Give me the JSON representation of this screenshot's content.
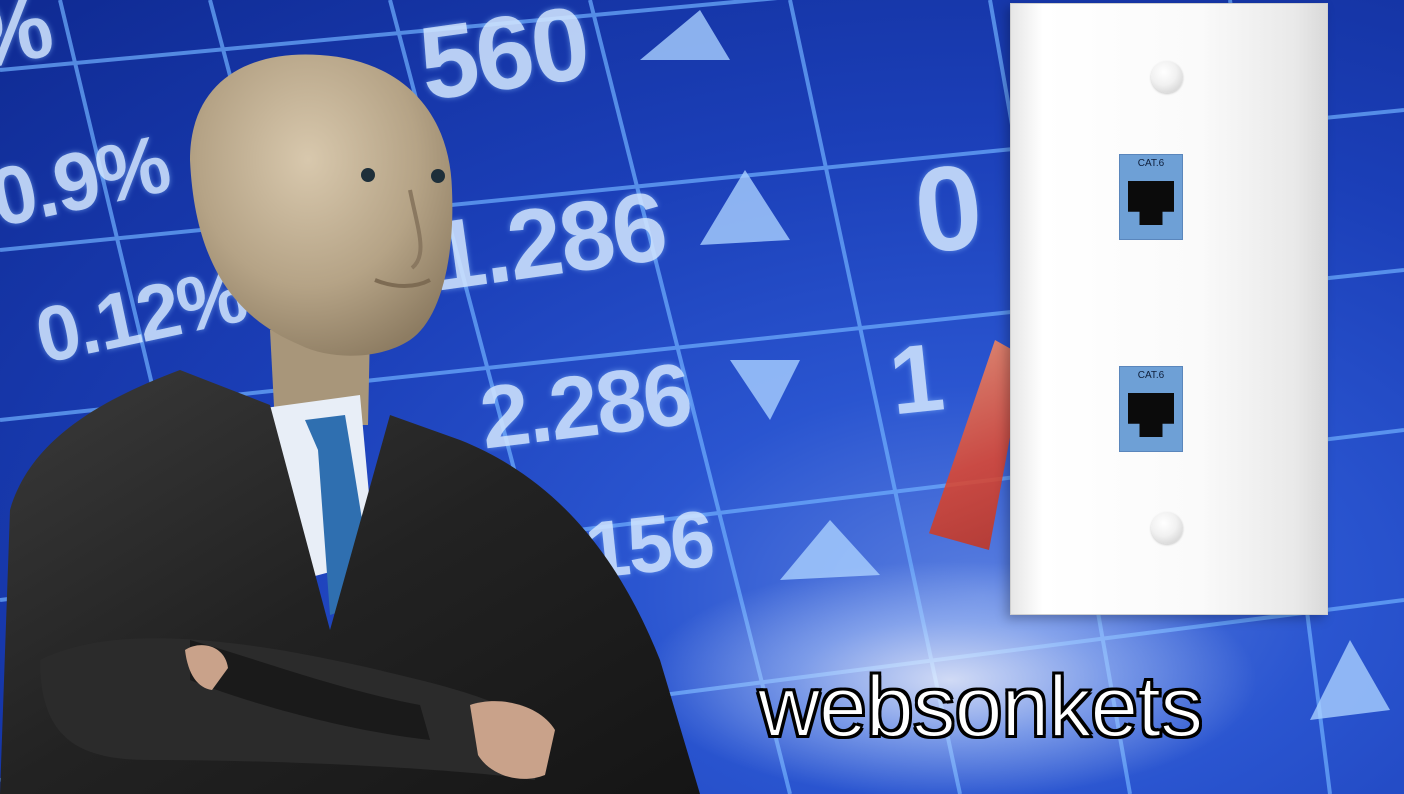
{
  "caption": "websonkets",
  "background": {
    "description_tag": "stock-ticker-board",
    "tickers": [
      "560",
      "1.286",
      "2.286",
      ".156",
      "%",
      "0.9%",
      "0.12%",
      "0",
      "1"
    ],
    "colors": {
      "board": "#1b3fb8",
      "grid": "#6fb0ff",
      "text": "#cfe4ff",
      "arrow_red": "#e2452a"
    }
  },
  "wall_plate": {
    "jacks": [
      {
        "label": "CAT.6"
      },
      {
        "label": "CAT.6"
      }
    ]
  }
}
